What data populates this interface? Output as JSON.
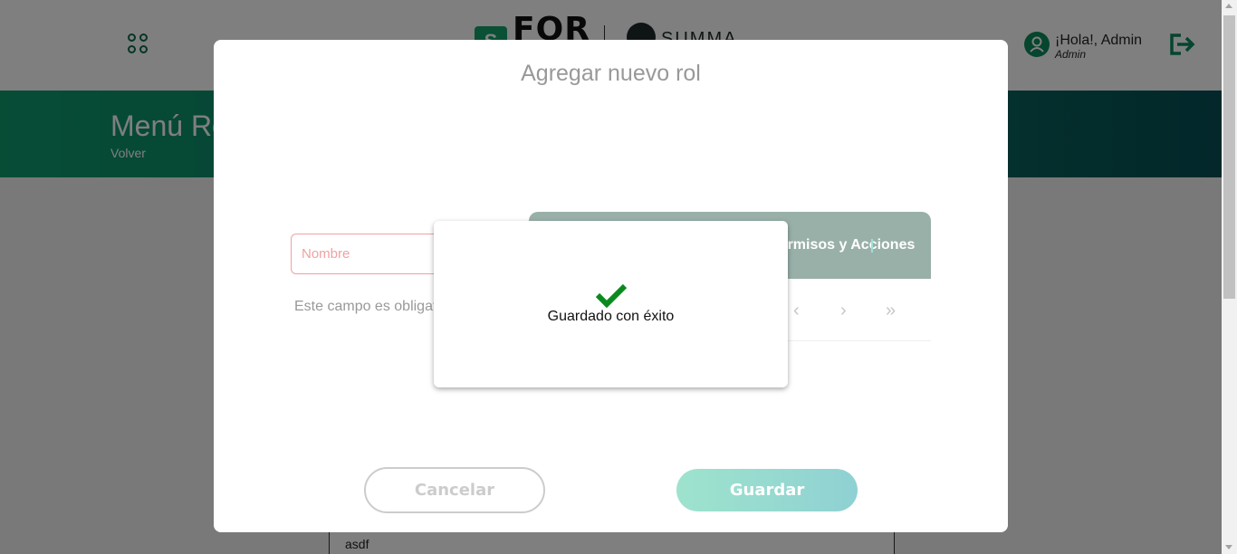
{
  "header": {
    "apps_icon": "apps-grid-icon",
    "logo_s": "S",
    "logo_for": "FOR",
    "partner_logo": "SUMMA",
    "greeting": "¡Hola!, Admin",
    "role": "Admin",
    "logout_icon": "logout-icon"
  },
  "hero": {
    "title": "Menú Roles",
    "back_link": "Volver"
  },
  "background_table": {
    "cell": "asdf"
  },
  "modal": {
    "title": "Agregar nuevo rol",
    "name_placeholder": "Nombre",
    "name_value": "",
    "required_msg": "Este campo es obligatorio",
    "permissions_header": "Permisos y Acciones",
    "pager": {
      "prev": "‹",
      "next": "›",
      "last": "»"
    },
    "cancel_label": "Cancelar",
    "save_label": "Guardar"
  },
  "toast": {
    "icon": "check-icon",
    "message": "Guardado con éxito"
  },
  "colors": {
    "brand_green": "#0e9a6d",
    "brand_dark": "#064e55",
    "success_check": "#0a8a1e",
    "error_border": "#f0a2a2"
  }
}
